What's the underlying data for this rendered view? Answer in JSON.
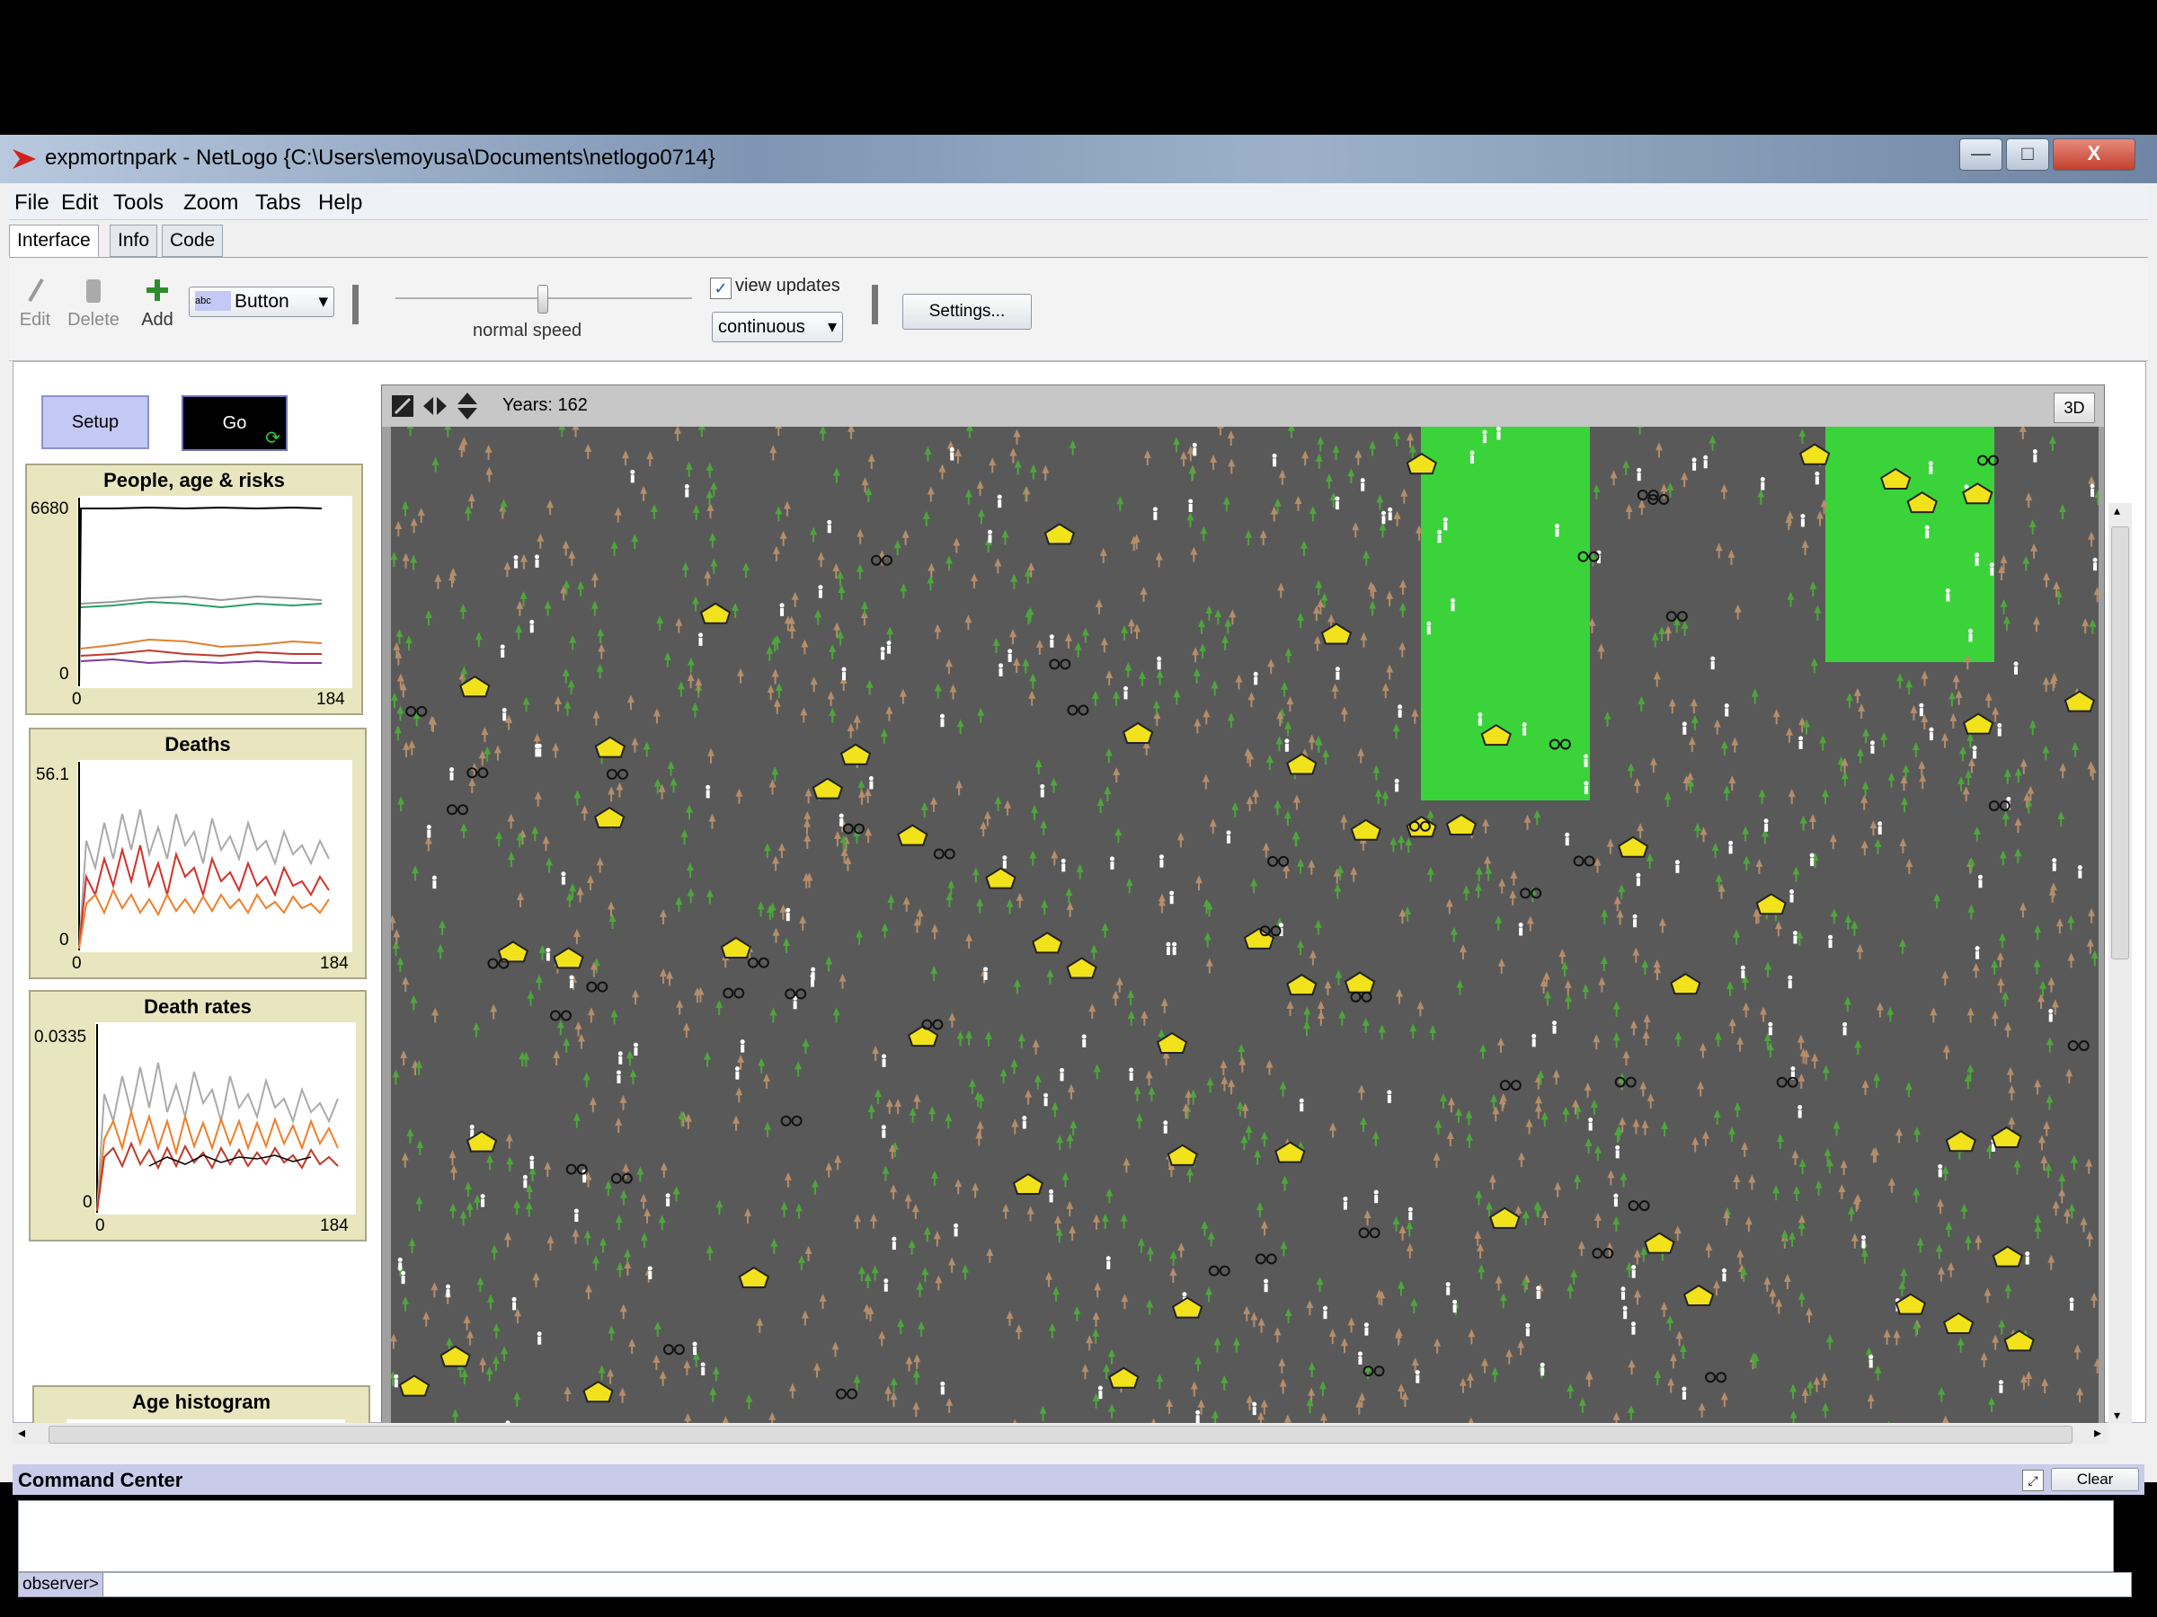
{
  "window": {
    "title": "expmortnpark - NetLogo {C:\\Users\\emoyusa\\Documents\\netlogo0714}",
    "minimize": "—",
    "maximize": "□",
    "close": "X"
  },
  "menu": [
    "File",
    "Edit",
    "Tools",
    "Zoom",
    "Tabs",
    "Help"
  ],
  "tabs": [
    "Interface",
    "Info",
    "Code"
  ],
  "toolbar": {
    "edit": "Edit",
    "delete": "Delete",
    "add": "Add",
    "widget_type": "Button",
    "speed_label": "normal speed",
    "view_updates_label": "view updates",
    "view_updates_checked": true,
    "update_mode": "continuous",
    "settings": "Settings..."
  },
  "buttons": {
    "setup": "Setup",
    "go": "Go"
  },
  "plots": [
    {
      "title": "People, age & risks",
      "ymax": "6680",
      "ymin": "0",
      "xmin": "0",
      "xmax": "184"
    },
    {
      "title": "Deaths",
      "ymax": "56.1",
      "ymin": "0",
      "xmin": "0",
      "xmax": "184"
    },
    {
      "title": "Death rates",
      "ymax": "0.0335",
      "ymin": "0",
      "xmin": "0",
      "xmax": "184"
    },
    {
      "title": "Age histogram"
    }
  ],
  "view": {
    "ticks_label": "Years: 162",
    "three_d": "3D"
  },
  "command_center": {
    "title": "Command Center",
    "clear": "Clear",
    "prompt": "observer>"
  },
  "colors": {
    "world_bg": "#595959",
    "park_green": "#3ad43a",
    "tree_green": "#4ea53c",
    "tree_brown": "#b58d6a",
    "house_yellow": "#f2e21b",
    "setup_button": "#c4c8f4",
    "plot_bg": "#e9e6bf"
  }
}
